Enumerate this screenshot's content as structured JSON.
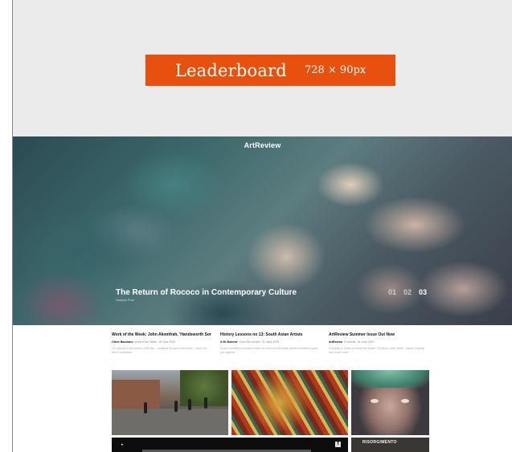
{
  "ad": {
    "title": "Leaderboard",
    "size": "728 × 90px",
    "accent_color": "#e8500e",
    "background_color": "#ebebeb"
  },
  "hero": {
    "site_name": "ArtReview",
    "title": "The Return of Rococo in Contemporary Culture",
    "subtitle": "Sample Post",
    "pager": [
      "01",
      "02",
      "03"
    ],
    "active_page": "03"
  },
  "articles": [
    {
      "title": "Work of the Week: John Akomfrah, 'Handsworth Songs'",
      "author": "Oliver Basciano",
      "category": "Work of the Week",
      "date": "18 June 2020",
      "desc": "The glories of the artist's 1986 film – available to watch this week – have not been overstated"
    },
    {
      "title": "History Lessons no 13: South Asian Artists",
      "author": "G.M. Butcher",
      "category": "From the archive",
      "date": "21 June 2020",
      "desc": "A rare revisiting of modern Asian art with a South Asian artist's exhibition apart put together"
    },
    {
      "title": "ArtReview Summer Issue Out Now",
      "author": "ArtReview",
      "category": "Previews",
      "date": "15 June 2020",
      "desc": "Solidarity in times of crisis from Brazil, Tia Bjorn, Jade Smith, Claude Drabbyl and much more"
    }
  ],
  "thumbs": [
    {
      "name": "street-scene"
    },
    {
      "name": "painting"
    },
    {
      "name": "face-portrait"
    }
  ],
  "video": {
    "play_icon": "▸",
    "share_icon": "f"
  },
  "risorgimento_label": "RISORGIMENTO"
}
